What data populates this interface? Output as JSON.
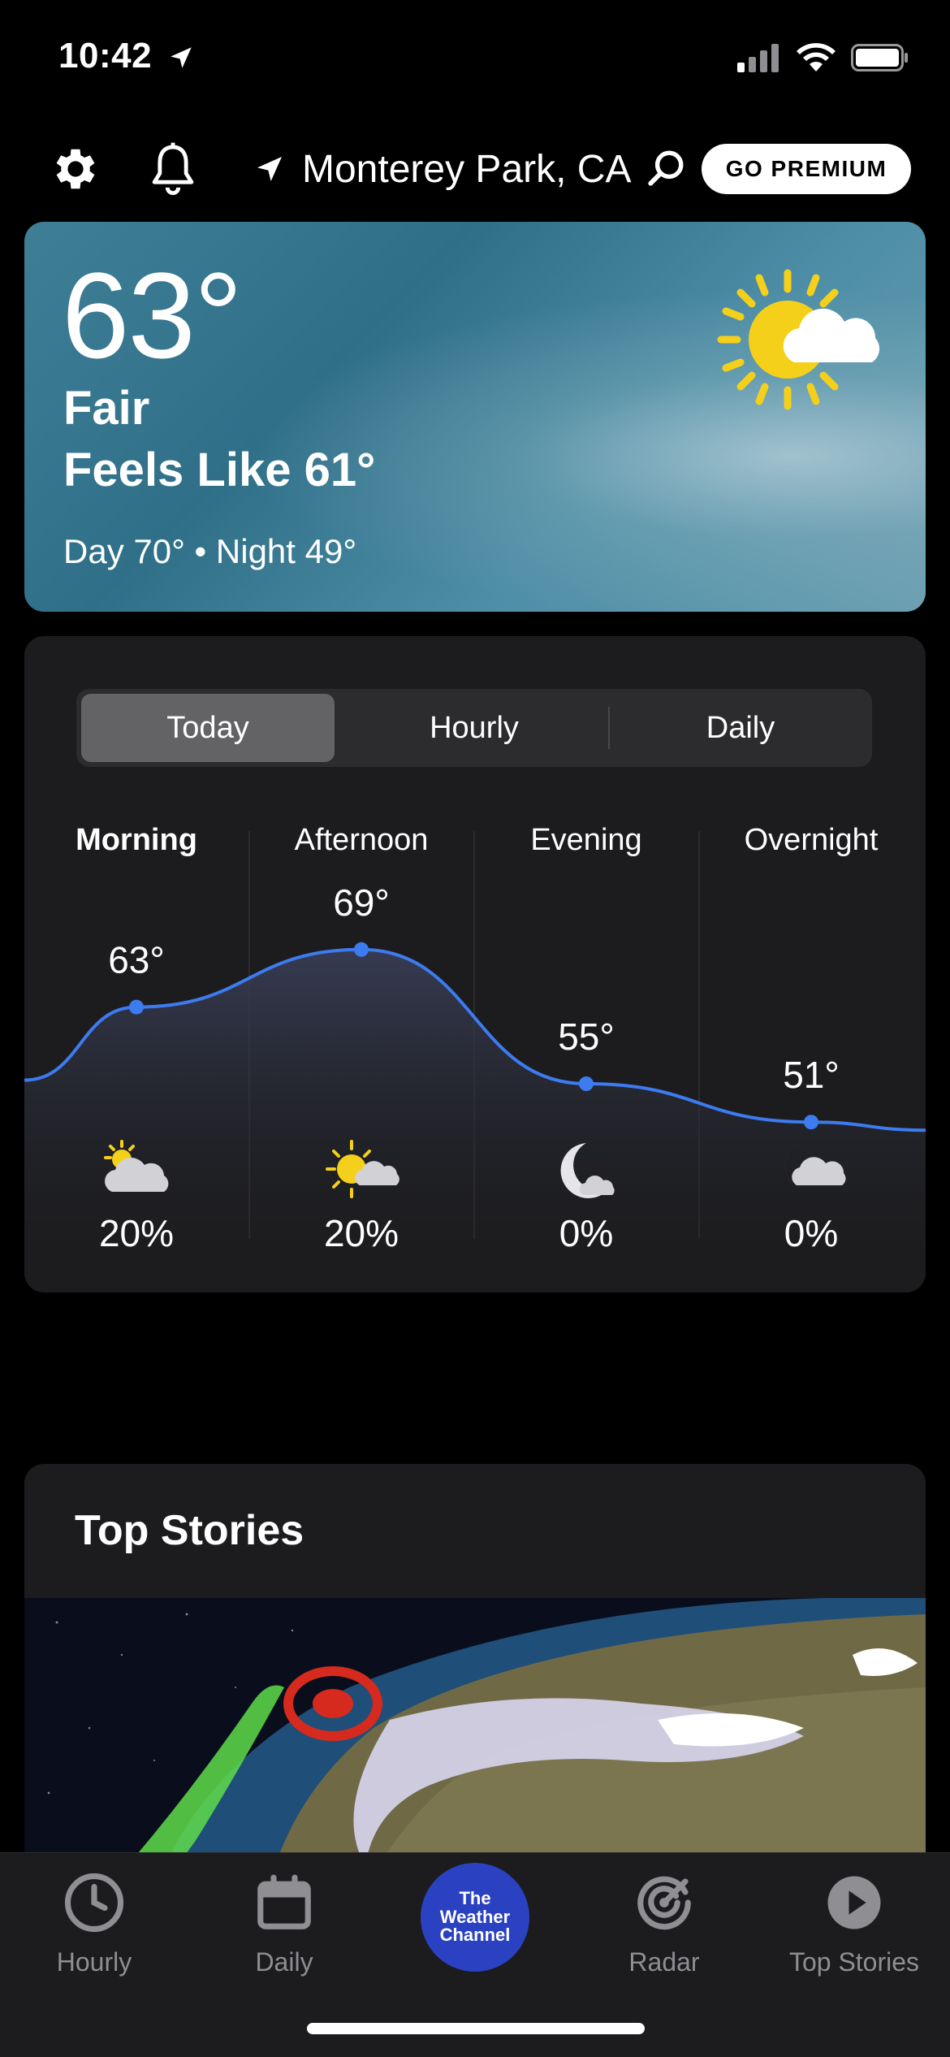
{
  "status_bar": {
    "time": "10:42"
  },
  "header": {
    "location": "Monterey Park, CA",
    "premium_label": "GO PREMIUM"
  },
  "current": {
    "temp": "63°",
    "condition": "Fair",
    "feels_like": "Feels Like 61°",
    "day_night": "Day 70° • Night 49°",
    "icon": "partly-sunny-icon"
  },
  "forecast": {
    "tabs": [
      "Today",
      "Hourly",
      "Daily"
    ],
    "active_tab": "Today",
    "periods": [
      {
        "label": "Morning",
        "temp": "63°",
        "temp_value": 63,
        "precip": "20%",
        "icon": "partly-cloudy-day-icon"
      },
      {
        "label": "Afternoon",
        "temp": "69°",
        "temp_value": 69,
        "precip": "20%",
        "icon": "mostly-sunny-icon"
      },
      {
        "label": "Evening",
        "temp": "55°",
        "temp_value": 55,
        "precip": "0%",
        "icon": "clear-night-icon"
      },
      {
        "label": "Overnight",
        "temp": "51°",
        "temp_value": 51,
        "precip": "0%",
        "icon": "partly-cloudy-night-icon"
      }
    ]
  },
  "stories": {
    "title": "Top Stories"
  },
  "tab_bar": {
    "items": [
      {
        "label": "Hourly",
        "icon": "clock-icon"
      },
      {
        "label": "Daily",
        "icon": "calendar-icon"
      },
      {
        "label": "The Weather Channel",
        "icon": "weather-channel-logo"
      },
      {
        "label": "Radar",
        "icon": "radar-icon"
      },
      {
        "label": "Top Stories",
        "icon": "play-icon"
      }
    ],
    "logo_lines": [
      "The",
      "Weather",
      "Channel"
    ]
  },
  "colors": {
    "accent_blue": "#3d7bf0",
    "logo_blue": "#2a41c2",
    "card_bg": "#1c1c1e",
    "sun_yellow": "#f5d01b"
  }
}
